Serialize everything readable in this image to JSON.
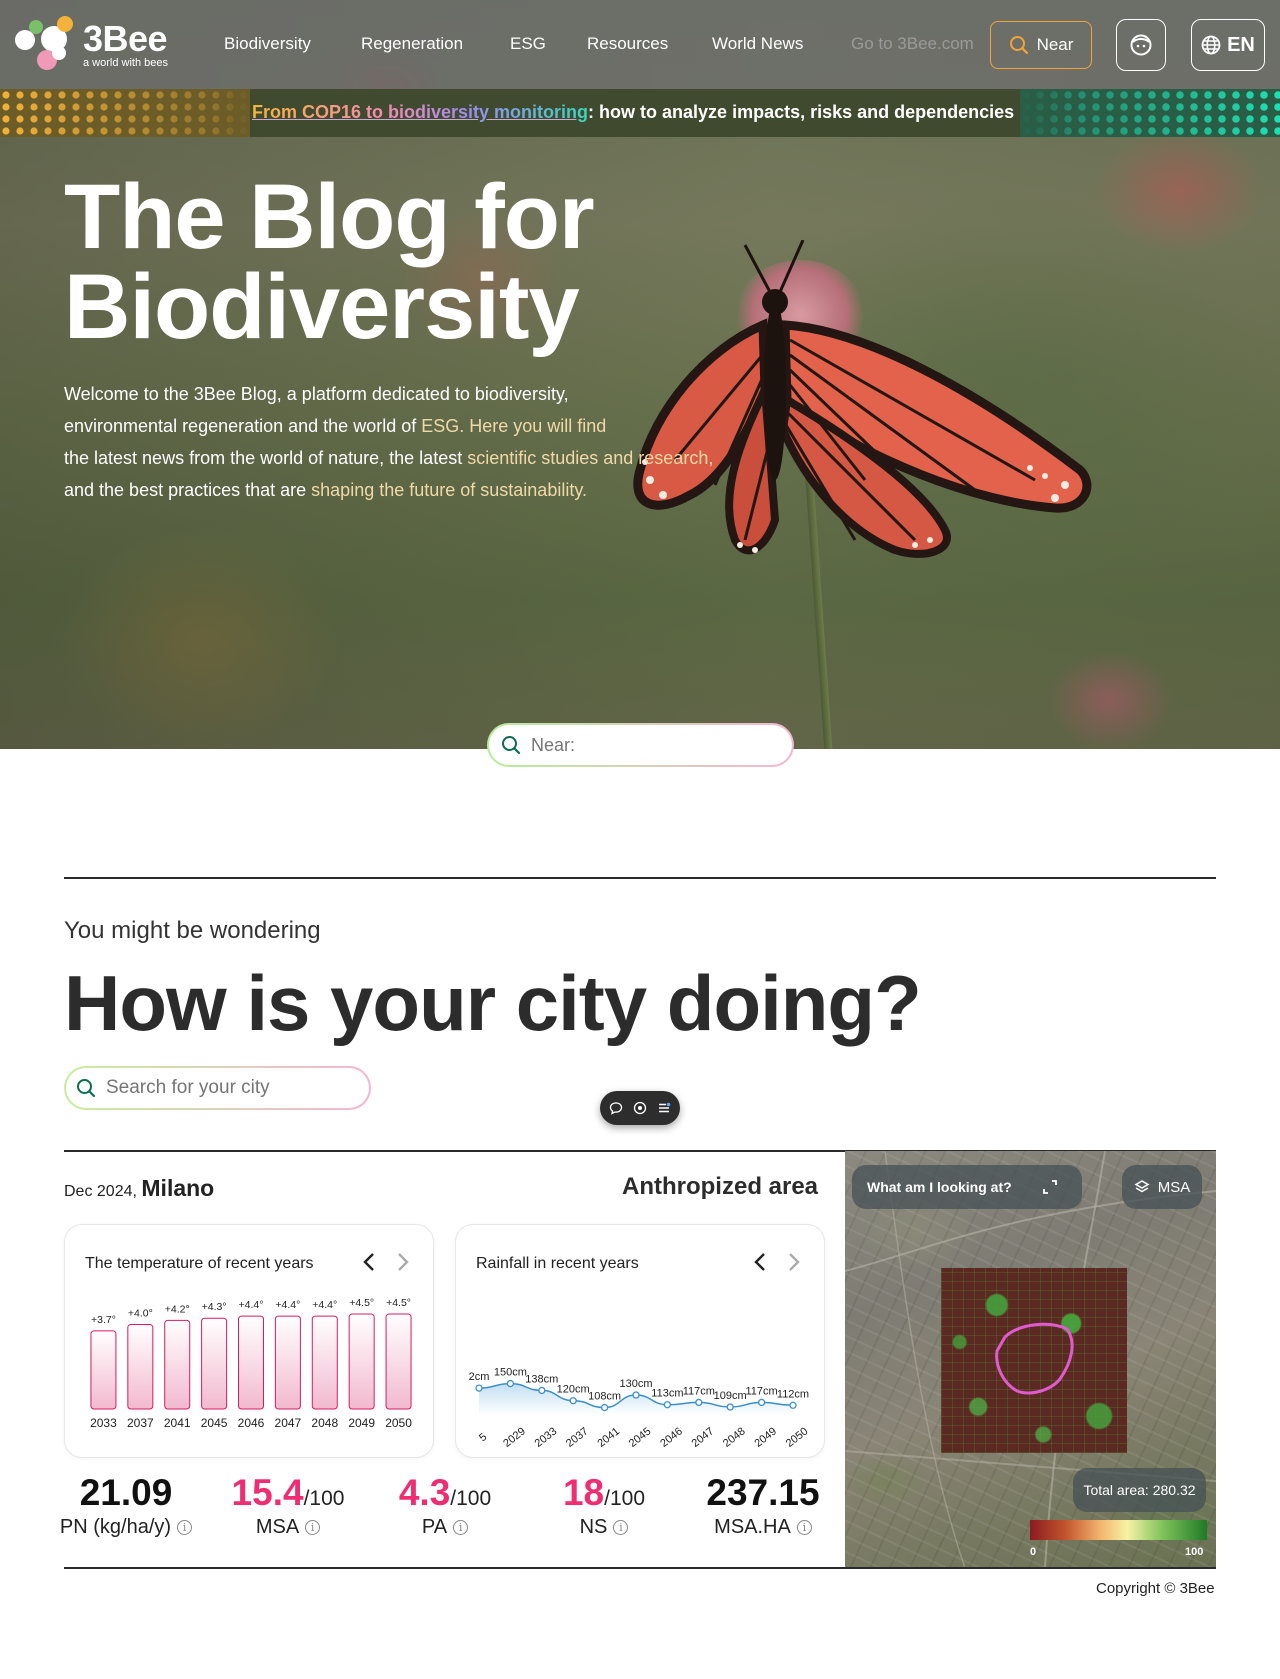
{
  "nav": {
    "logo_title": "3Bee",
    "logo_subtitle": "a world with bees",
    "links": [
      "Biodiversity",
      "Regeneration",
      "ESG",
      "Resources",
      "World News"
    ],
    "goto_link": "Go to 3Bee.com",
    "near_button": "Near",
    "lang_button": "EN"
  },
  "banner": {
    "link_text": "From COP16 to biodiversity monitoring",
    "rest_text": ": how to analyze impacts, risks and dependencies"
  },
  "hero": {
    "title_line1": "The Blog for",
    "title_line2": "Biodiversity",
    "desc_1": "Welcome to the 3Bee Blog, a platform dedicated to biodiversity,",
    "desc_2a": "environmental regeneration and the world of ",
    "desc_2b": "ESG. Here you will find",
    "desc_3a": "the latest news from the world of nature, the latest ",
    "desc_3b": "scientific studies and research,",
    "desc_4a": "and the best practices that are ",
    "desc_4b": "shaping the future of sustainability."
  },
  "near_search": {
    "placeholder": "Near:"
  },
  "city_section": {
    "kicker": "You might be wondering",
    "title": "How is your city doing?",
    "search_placeholder": "Search for your city",
    "date": "Dec 2024,",
    "city": "Milano",
    "anthropized_label": "Anthropized area"
  },
  "temperature_card": {
    "title": "The temperature of recent years"
  },
  "rainfall_card": {
    "title": "Rainfall in recent years"
  },
  "chart_data": [
    {
      "type": "bar",
      "title": "The temperature of recent years",
      "categories": [
        "2033",
        "2037",
        "2041",
        "2045",
        "2046",
        "2047",
        "2048",
        "2049",
        "2050"
      ],
      "labels": [
        "+3.7°",
        "+4.0°",
        "+4.2°",
        "+4.3°",
        "+4.4°",
        "+4.4°",
        "+4.4°",
        "+4.5°",
        "+4.5°"
      ],
      "values": [
        3.7,
        4.0,
        4.2,
        4.3,
        4.4,
        4.4,
        4.4,
        4.5,
        4.5
      ],
      "colors": {
        "fill_top": "#ffffff",
        "fill_bottom": "#f2b9ce",
        "stroke": "#d81b60"
      }
    },
    {
      "type": "area",
      "title": "Rainfall in recent years",
      "x_visible_first": "5",
      "x": [
        "2029",
        "2033",
        "2037",
        "2041",
        "2045",
        "2046",
        "2047",
        "2048",
        "2049",
        "2050"
      ],
      "labels": [
        "2cm",
        "150cm",
        "138cm",
        "120cm",
        "108cm",
        "130cm",
        "113cm",
        "117cm",
        "109cm",
        "117cm",
        "112cm"
      ],
      "values": [
        142,
        150,
        138,
        120,
        108,
        130,
        113,
        117,
        109,
        117,
        112
      ],
      "colors": {
        "line": "#3b8fc9",
        "fill_top": "#bcdcf0",
        "fill_bottom": "#ffffff"
      }
    }
  ],
  "metrics": [
    {
      "value": "21.09",
      "suffix": "",
      "label": "PN (kg/ha/y)",
      "pink": false
    },
    {
      "value": "15.4",
      "suffix": "/100",
      "label": "MSA",
      "pink": true
    },
    {
      "value": "4.3",
      "suffix": "/100",
      "label": "PA",
      "pink": true
    },
    {
      "value": "18",
      "suffix": "/100",
      "label": "NS",
      "pink": true
    },
    {
      "value": "237.15",
      "suffix": "",
      "label": "MSA.HA",
      "pink": false
    }
  ],
  "map": {
    "what_label": "What am I looking at?",
    "msa_label": "MSA",
    "total_area": "Total area: 280.32",
    "legend_min": "0",
    "legend_max": "100"
  },
  "footer": {
    "copyright": "Copyright © 3Bee"
  },
  "colors": {
    "accent_orange": "#f2a43a",
    "accent_pink": "#ee2d72",
    "nav_bg": "#6e6e6e"
  }
}
